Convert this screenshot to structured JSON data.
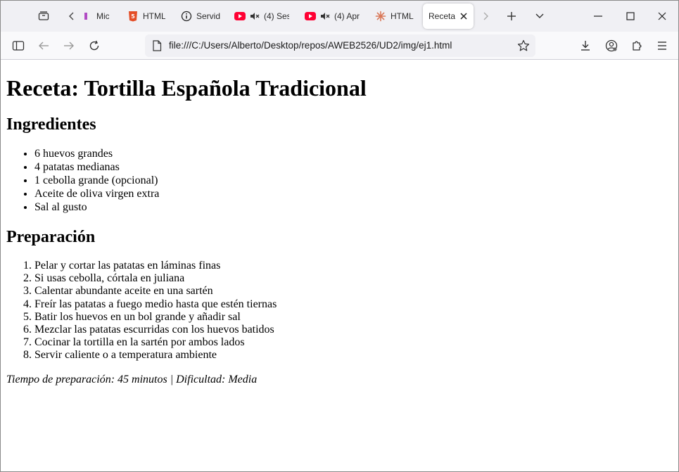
{
  "browser": {
    "tabs": [
      {
        "label": "Micros",
        "icon": "microsoft-favicon"
      },
      {
        "label": "HTML",
        "icon": "html5-favicon"
      },
      {
        "label": "Servid",
        "icon": "info-favicon"
      },
      {
        "label": "(4) Ses",
        "icon": "youtube-favicon",
        "muted": true
      },
      {
        "label": "(4) Apr",
        "icon": "youtube-favicon",
        "muted": true
      },
      {
        "label": "HTML",
        "icon": "claude-favicon"
      },
      {
        "label": "Receta:",
        "icon": "none",
        "active": true
      }
    ],
    "url": "file:///C:/Users/Alberto/Desktop/repos/AWEB2526/UD2/img/ej1.html"
  },
  "page": {
    "title": "Receta: Tortilla Española Tradicional",
    "ingredients_heading": "Ingredientes",
    "ingredients": [
      "6 huevos grandes",
      "4 patatas medianas",
      "1 cebolla grande (opcional)",
      "Aceite de oliva virgen extra",
      "Sal al gusto"
    ],
    "preparation_heading": "Preparación",
    "steps": [
      "Pelar y cortar las patatas en láminas finas",
      "Si usas cebolla, córtala en juliana",
      "Calentar abundante aceite en una sartén",
      "Freír las patatas a fuego medio hasta que estén tiernas",
      "Batir los huevos en un bol grande y añadir sal",
      "Mezclar las patatas escurridas con los huevos batidos",
      "Cocinar la tortilla en la sartén por ambos lados",
      "Servir caliente o a temperatura ambiente"
    ],
    "footer": "Tiempo de preparación: 45 minutos | Dificultad: Media"
  },
  "colors": {
    "youtube": "#ff0033",
    "html5": "#e44d26",
    "claude": "#d97757",
    "tabstrip_bg": "#f0f0f4"
  }
}
